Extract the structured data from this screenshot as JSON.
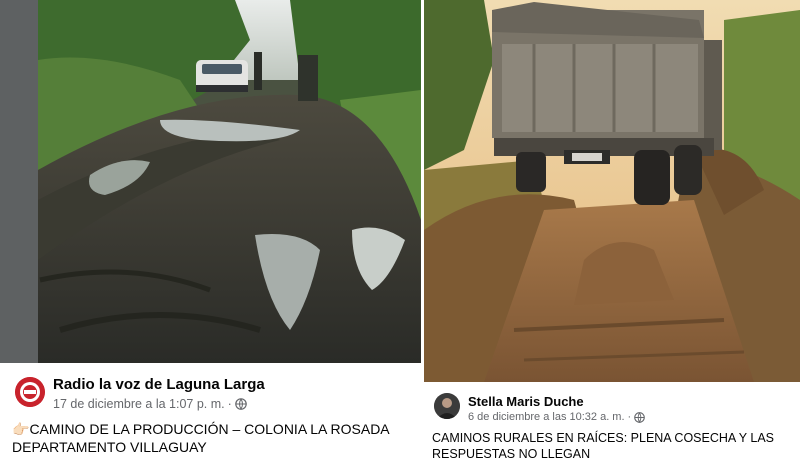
{
  "left_post": {
    "author": "Radio la voz de Laguna Larga",
    "timestamp": "17 de diciembre a la 1:07 p. m.",
    "separator": "·",
    "privacy_icon": "globe-icon",
    "pointer_emoji": "👉🏻",
    "text_line1": "CAMINO DE LA PRODUCCIÓN – COLONIA LA ROSADA",
    "text_line2": "DEPARTAMENTO  VILLAGUAY"
  },
  "right_post": {
    "author": "Stella Maris Duche",
    "timestamp": "6 de diciembre a las 10:32 a. m.",
    "separator": "·",
    "privacy_icon": "globe-icon",
    "text_line1": "CAMINOS RURALES EN RAÍCES: PLENA COSECHA Y LAS",
    "text_line2": "RESPUESTAS NO LLEGAN"
  },
  "colors": {
    "author_text": "#050505",
    "meta_text": "#65676b",
    "left_avatar_bg": "#c8232c",
    "right_avatar_bg": "#3b3b3b"
  }
}
